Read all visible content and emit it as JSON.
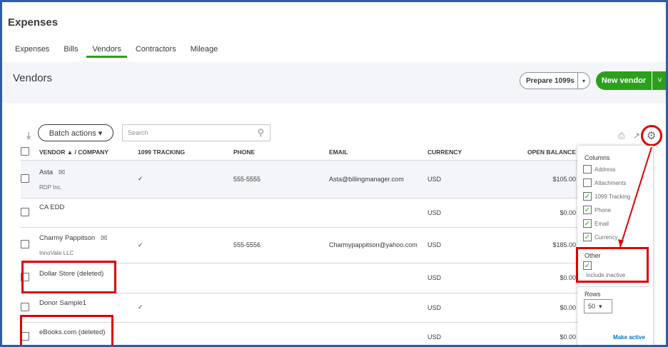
{
  "page": {
    "title": "Expenses"
  },
  "tabs": [
    {
      "label": "Expenses"
    },
    {
      "label": "Bills"
    },
    {
      "label": "Vendors"
    },
    {
      "label": "Contractors"
    },
    {
      "label": "Mileage"
    }
  ],
  "header": {
    "title": "Vendors",
    "prepare_label": "Prepare 1099s",
    "new_vendor_label": "New vendor"
  },
  "toolbar": {
    "batch_label": "Batch actions ▾",
    "search_placeholder": "Search"
  },
  "table": {
    "columns": [
      "VENDOR ▲ / COMPANY",
      "1099 TRACKING",
      "PHONE",
      "EMAIL",
      "CURRENCY",
      "OPEN BALANCE"
    ],
    "rows": [
      {
        "name": "Asta",
        "company": "RDP Inc.",
        "tracking": "✓",
        "phone": "555-5555",
        "email": "Asta@billingmanager.com",
        "currency": "USD",
        "balance": "$105.00"
      },
      {
        "name": "CA EDD",
        "company": "",
        "tracking": "",
        "phone": "",
        "email": "",
        "currency": "USD",
        "balance": "$0.00"
      },
      {
        "name": "Charmy Pappitson",
        "company": "InnoVate LLC",
        "tracking": "✓",
        "phone": "555-5556",
        "email": "Charmypappitson@yahoo.com",
        "currency": "USD",
        "balance": "$185.00"
      },
      {
        "name": "Dollar Store (deleted)",
        "company": "",
        "tracking": "",
        "phone": "",
        "email": "",
        "currency": "USD",
        "balance": "$0.00"
      },
      {
        "name": "Donor Sample1",
        "company": "",
        "tracking": "✓",
        "phone": "",
        "email": "",
        "currency": "USD",
        "balance": "$0.00"
      },
      {
        "name": "eBooks.com (deleted)",
        "company": "",
        "tracking": "",
        "phone": "",
        "email": "",
        "currency": "USD",
        "balance": "$0.00"
      }
    ]
  },
  "settings_panel": {
    "columns_label": "Columns",
    "columns": [
      {
        "label": "Address",
        "checked": false
      },
      {
        "label": "Attachments",
        "checked": false
      },
      {
        "label": "1099 Tracking",
        "checked": true
      },
      {
        "label": "Phone",
        "checked": true
      },
      {
        "label": "Email",
        "checked": true
      },
      {
        "label": "Currency",
        "checked": true
      }
    ],
    "other_label": "Other",
    "include_inactive_label": "Include inactive",
    "rows_label": "Rows",
    "rows_value": "50",
    "make_active_label": "Make active"
  },
  "colors": {
    "accent_green": "#2ca01c",
    "highlight_red": "#e00000",
    "link_blue": "#0077c5"
  },
  "icons": [
    "sort-icon",
    "search-icon",
    "print-icon",
    "export-icon",
    "gear-icon",
    "mail-icon",
    "check-icon"
  ]
}
